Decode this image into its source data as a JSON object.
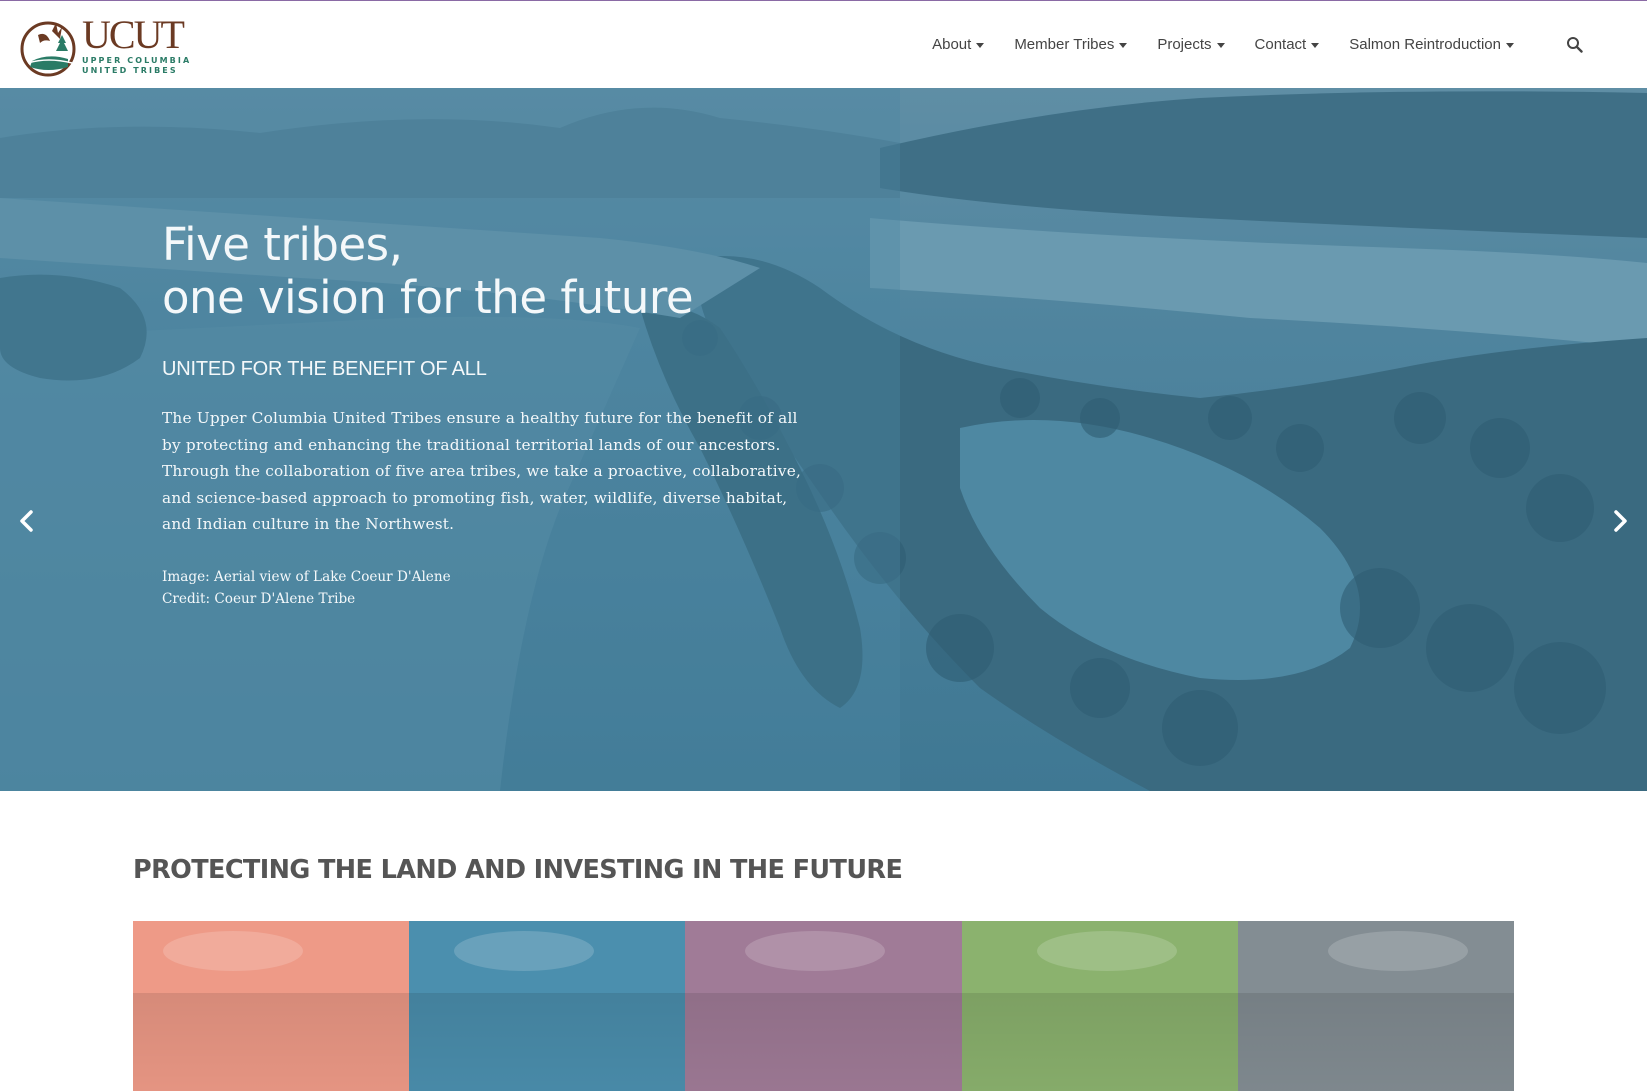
{
  "header": {
    "logo": {
      "wordmark": "UCUT",
      "line1": "UPPER COLUMBIA",
      "line2": "UNITED TRIBES"
    },
    "nav": [
      {
        "label": "About"
      },
      {
        "label": "Member Tribes"
      },
      {
        "label": "Projects"
      },
      {
        "label": "Contact"
      },
      {
        "label": "Salmon Reintroduction"
      }
    ],
    "search_icon": "search-icon"
  },
  "hero": {
    "title_line1": "Five tribes,",
    "title_line2": "one vision for the future",
    "subtitle": "UNITED FOR THE BENEFIT OF ALL",
    "body": "The Upper Columbia United Tribes ensure a healthy future for the benefit of all by protecting and enhancing the traditional territorial lands of our ancestors. Through the collaboration of five area tribes, we take a proactive, collaborative, and science-based approach to promoting fish, water, wildlife, diverse habitat, and Indian culture in the Northwest.",
    "image_caption": "Image: Aerial view of Lake Coeur D'Alene",
    "image_credit": "Credit: Coeur D'Alene Tribe",
    "prev_icon": "chevron-left-icon",
    "next_icon": "chevron-right-icon"
  },
  "section": {
    "title": "PROTECTING THE LAND AND INVESTING IN THE FUTURE",
    "tiles": [
      {
        "color": "#ee9a87"
      },
      {
        "color": "#4b8fae"
      },
      {
        "color": "#a07b97"
      },
      {
        "color": "#8bb26e"
      },
      {
        "color": "#838d93"
      }
    ]
  },
  "colors": {
    "accent_border": "#8a6aa5",
    "hero_overlay": "#4f849e",
    "logo_brown": "#6b3a23",
    "logo_green": "#2a7b66"
  }
}
